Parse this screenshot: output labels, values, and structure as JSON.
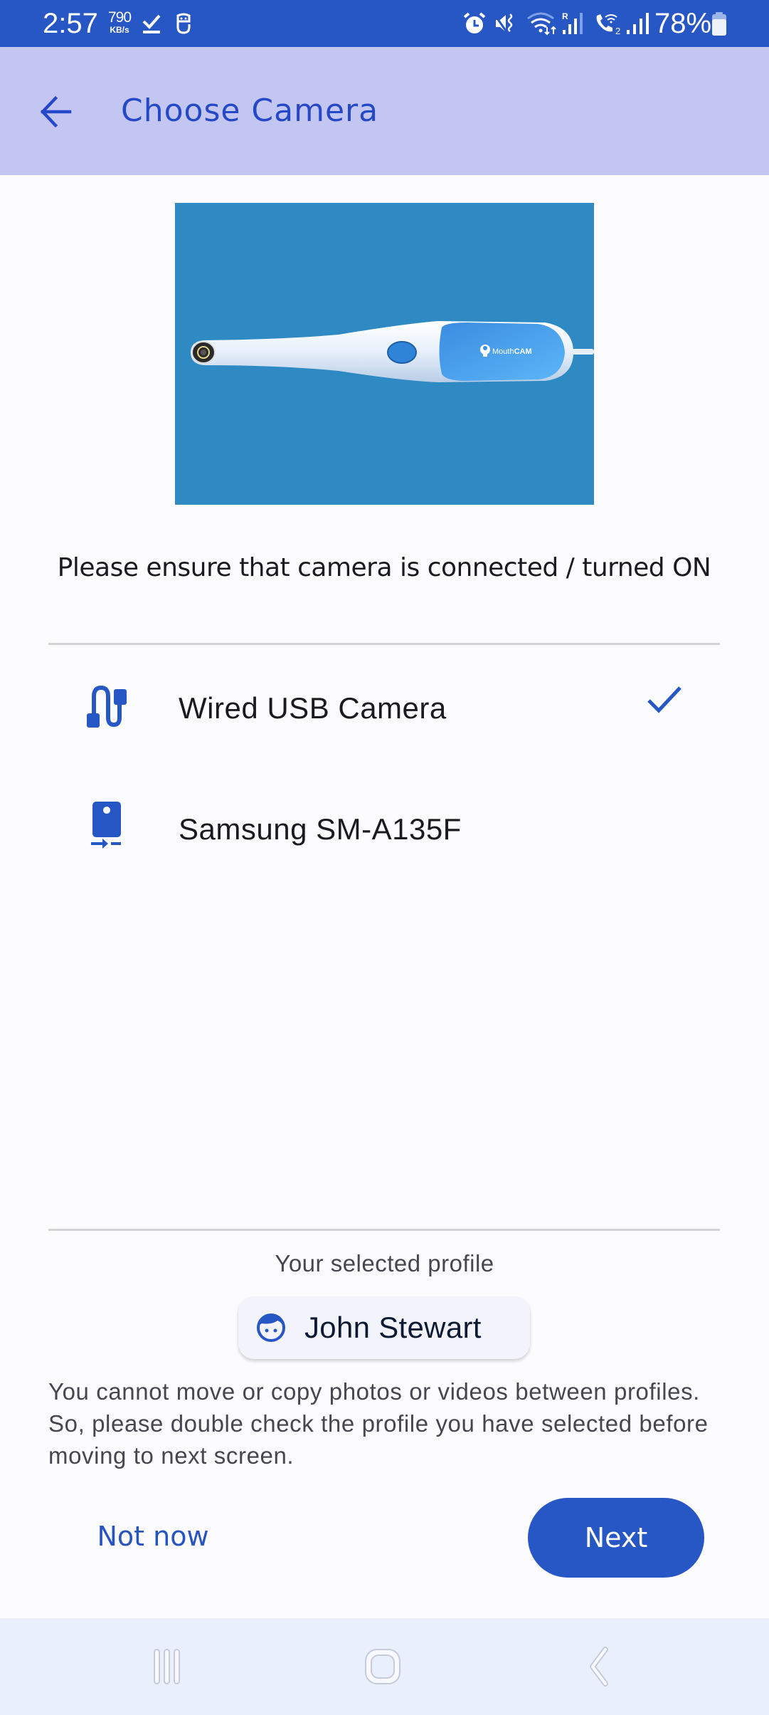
{
  "status_bar": {
    "time": "2:57",
    "net_speed_value": "790",
    "net_speed_unit": "KB/s",
    "left_icons": [
      "download-done-icon",
      "app-notification-icon"
    ],
    "right_icons": [
      "alarm-icon",
      "mute-vibrate-icon",
      "wifi-icon",
      "signal-roaming-icon",
      "wifi-calling-icon",
      "signal-icon"
    ],
    "battery_percent": "78%"
  },
  "app_bar": {
    "back_icon": "arrow-back-icon",
    "title": "Choose Camera"
  },
  "hero": {
    "image_alt": "MouthCAM intraoral camera",
    "brand_text_light": "Mouth",
    "brand_text_bold": "CAM"
  },
  "instruction": "Please ensure that camera is connected / turned ON",
  "cameras": [
    {
      "label": "Wired USB Camera",
      "icon": "usb-cable-icon",
      "selected": true
    },
    {
      "label": "Samsung SM-A135F",
      "icon": "phone-camera-icon",
      "selected": false
    }
  ],
  "profile": {
    "caption": "Your selected profile",
    "name": "John Stewart",
    "avatar_icon": "face-icon"
  },
  "warning": "You cannot move or copy photos or videos between profiles. So, please double check the profile you have selected before moving to next screen.",
  "actions": {
    "secondary_label": "Not now",
    "primary_label": "Next"
  },
  "nav_bar": {
    "recents_icon": "recents-icon",
    "home_icon": "home-icon",
    "back_icon": "back-chevron-icon"
  },
  "colors": {
    "primary": "#2757c4",
    "app_bar_bg": "#c4c6f2",
    "title_text": "#2548c8",
    "hero_bg": "#2f8ac4"
  }
}
